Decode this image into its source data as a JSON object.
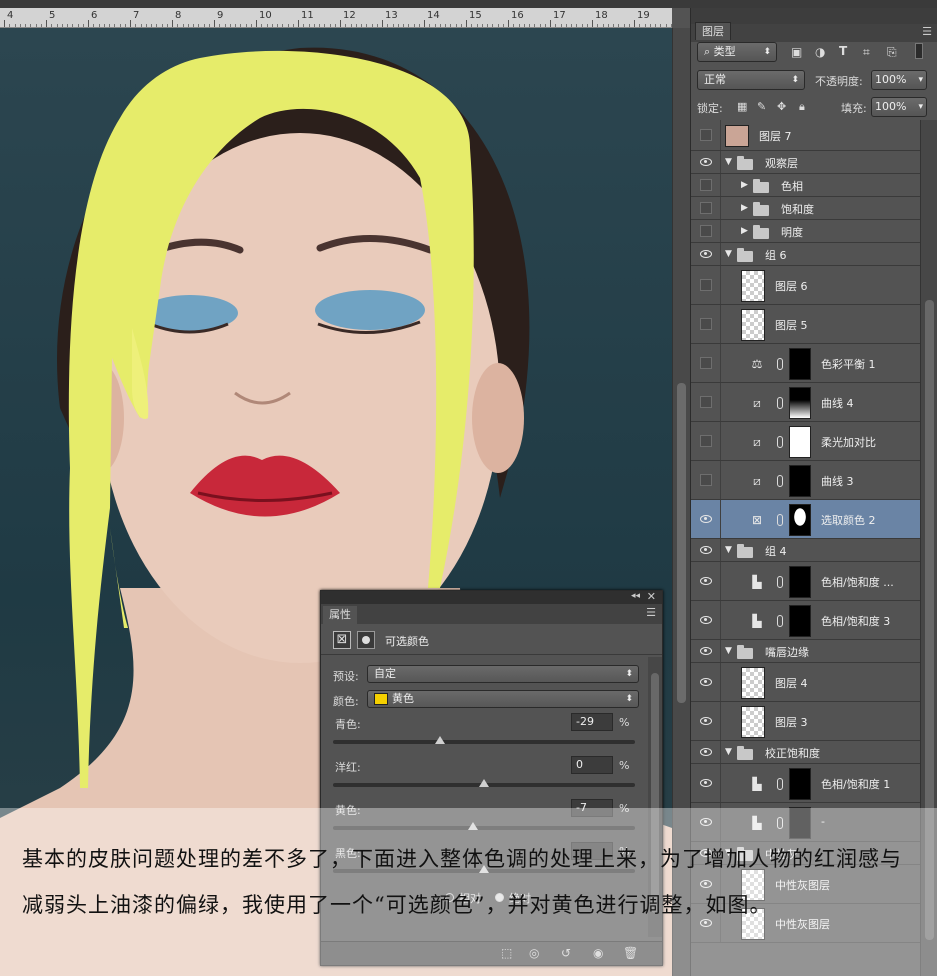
{
  "ruler": {
    "ticks": [
      "4",
      "5",
      "6",
      "7",
      "8",
      "9",
      "10",
      "11",
      "12",
      "13",
      "14",
      "15",
      "16",
      "17",
      "18",
      "19"
    ]
  },
  "layers_panel": {
    "tab": "图层",
    "filter_kind": "类型",
    "filter_icons": [
      "image-filter-icon",
      "adjustment-filter-icon",
      "text-filter-icon",
      "shape-filter-icon",
      "smart-filter-icon"
    ],
    "blend_mode": "正常",
    "opacity_label": "不透明度:",
    "opacity_value": "100%",
    "lock_label": "锁定:",
    "fill_label": "填充:",
    "fill_value": "100%",
    "rows": [
      {
        "name": "图层 7",
        "kind": "layer-photo",
        "visible": false,
        "indent": 0
      },
      {
        "name": "观察层",
        "kind": "group",
        "visible": true,
        "indent": 0,
        "open": true
      },
      {
        "name": "色相",
        "kind": "group",
        "visible": false,
        "indent": 1,
        "open": false
      },
      {
        "name": "饱和度",
        "kind": "group",
        "visible": false,
        "indent": 1,
        "open": false
      },
      {
        "name": "明度",
        "kind": "group",
        "visible": false,
        "indent": 1,
        "open": false
      },
      {
        "name": "组 6",
        "kind": "group",
        "visible": true,
        "indent": 0,
        "open": true
      },
      {
        "name": "图层 6",
        "kind": "layer",
        "visible": false,
        "indent": 1
      },
      {
        "name": "图层 5",
        "kind": "layer",
        "visible": false,
        "indent": 1
      },
      {
        "name": "色彩平衡 1",
        "kind": "adjustment",
        "icon": "balance-icon",
        "visible": false,
        "indent": 1
      },
      {
        "name": "曲线 4",
        "kind": "adjustment",
        "icon": "curves-icon",
        "visible": false,
        "indent": 1
      },
      {
        "name": "柔光加对比",
        "kind": "adjustment",
        "icon": "curves-icon",
        "visible": false,
        "indent": 1
      },
      {
        "name": "曲线 3",
        "kind": "adjustment",
        "icon": "curves-icon",
        "visible": false,
        "indent": 1
      },
      {
        "name": "选取颜色 2",
        "kind": "adjustment",
        "icon": "selective-color-icon",
        "visible": true,
        "indent": 1,
        "selected": true
      },
      {
        "name": "组 4",
        "kind": "group",
        "visible": true,
        "indent": 0,
        "open": true
      },
      {
        "name": "色相/饱和度 ...",
        "kind": "adjustment",
        "icon": "hue-sat-icon",
        "visible": true,
        "indent": 1
      },
      {
        "name": "色相/饱和度 3",
        "kind": "adjustment",
        "icon": "hue-sat-icon",
        "visible": true,
        "indent": 1
      },
      {
        "name": "嘴唇边缘",
        "kind": "group",
        "visible": true,
        "indent": 0,
        "open": true
      },
      {
        "name": "图层 4",
        "kind": "layer",
        "visible": true,
        "indent": 1
      },
      {
        "name": "图层 3",
        "kind": "layer",
        "visible": true,
        "indent": 1
      },
      {
        "name": "校正饱和度",
        "kind": "group",
        "visible": true,
        "indent": 0,
        "open": true
      },
      {
        "name": "色相/饱和度 1",
        "kind": "adjustment",
        "icon": "hue-sat-icon",
        "visible": true,
        "indent": 1
      },
      {
        "name": "-",
        "kind": "adjustment",
        "icon": "hue-sat-icon",
        "visible": true,
        "indent": 1
      },
      {
        "name": "中性灰",
        "kind": "group",
        "visible": true,
        "indent": 0,
        "open": true
      },
      {
        "name": "中性灰图层",
        "kind": "layer",
        "visible": true,
        "indent": 1
      },
      {
        "name": "中性灰图层",
        "kind": "layer",
        "visible": true,
        "indent": 1
      }
    ]
  },
  "properties_panel": {
    "tab": "属性",
    "title": "可选颜色",
    "preset_label": "预设:",
    "preset_value": "自定",
    "color_label": "颜色:",
    "color_value": "黄色",
    "color_swatch": "#f5d000",
    "sliders": [
      {
        "label": "青色:",
        "value": "-29",
        "unit": "%",
        "level": -29
      },
      {
        "label": "洋红:",
        "value": "0",
        "unit": "%",
        "level": 0
      },
      {
        "label": "黄色:",
        "value": "-7",
        "unit": "%",
        "level": -7
      },
      {
        "label": "黑色:",
        "value": "",
        "unit": "%",
        "level": 0
      }
    ],
    "method_relative": "相对",
    "method_absolute": "绝对",
    "footer_icons": [
      "clip-icon",
      "view-previous-icon",
      "reset-icon",
      "visibility-icon",
      "trash-icon"
    ]
  },
  "caption": {
    "text": "基本的皮肤问题处理的差不多了，下面进入整体色调的处理上来，为了增加人物的红润感与减弱头上油漆的偏绿，我使用了一个“可选颜色”，并对黄色进行调整，如图。"
  },
  "colors": {
    "selected_row": "#6a84a5",
    "paint": "#e6ec6a",
    "lips": "#c8283a",
    "eyeshadow": "#5a9cc4",
    "background": "#1f3a44"
  }
}
